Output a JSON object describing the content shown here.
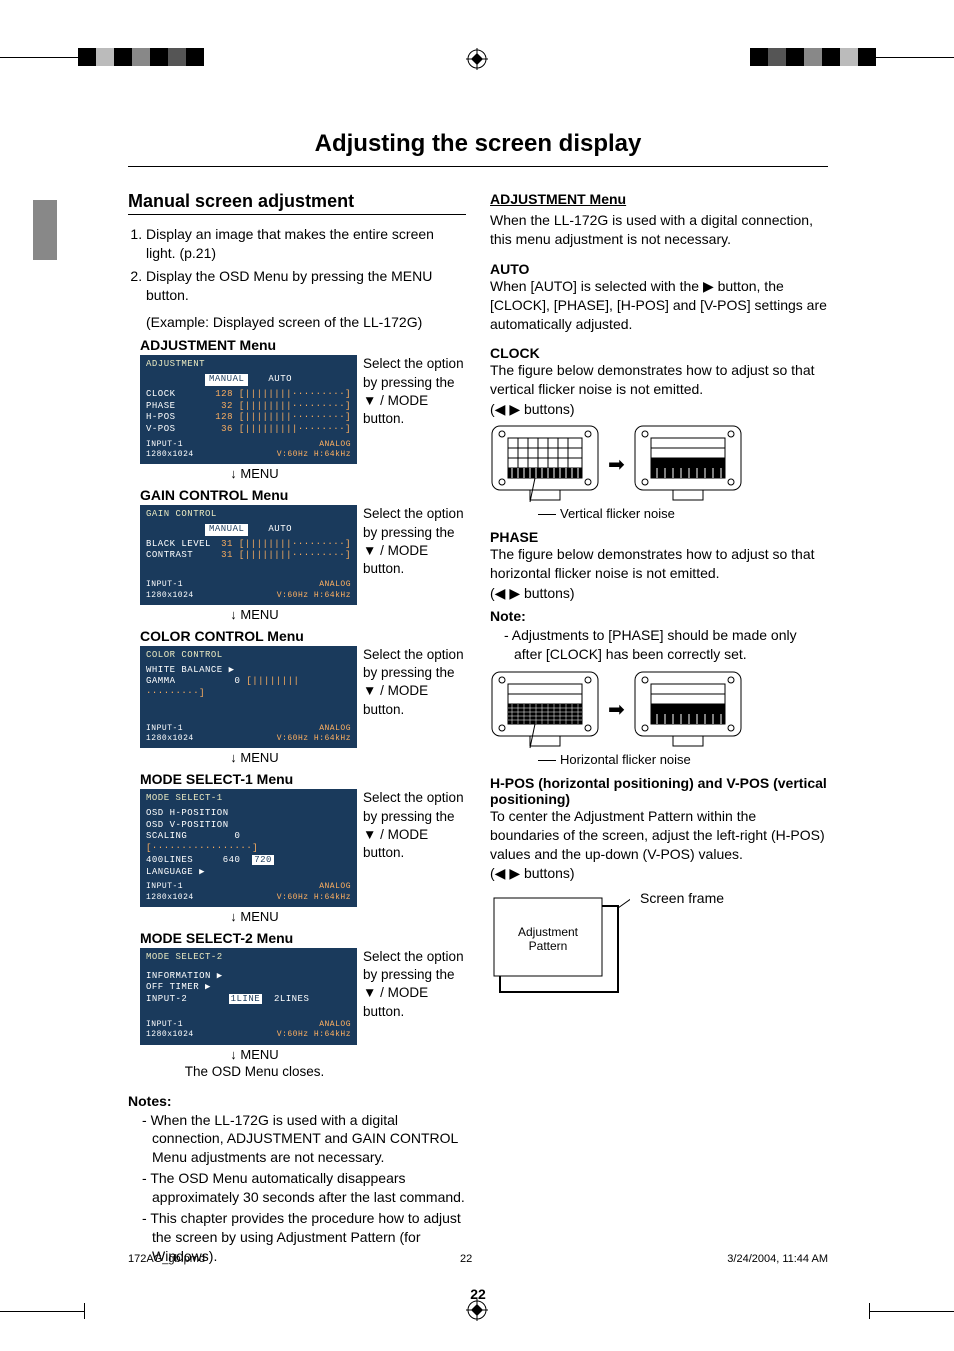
{
  "main_title": "Adjusting the screen display",
  "left": {
    "section_title": "Manual screen adjustment",
    "steps": [
      "Display an image that makes the entire screen light. (p.21)",
      "Display the OSD Menu by pressing the MENU button."
    ],
    "example": "(Example: Displayed screen of the LL-172G)",
    "menus": {
      "adjustment": {
        "label": "ADJUSTMENT Menu",
        "osd_title": "ADJUSTMENT",
        "tabs": [
          "MANUAL",
          "AUTO"
        ],
        "rows": [
          {
            "k": "CLOCK",
            "v": "128"
          },
          {
            "k": "PHASE",
            "v": "32"
          },
          {
            "k": "H-POS",
            "v": "128"
          },
          {
            "k": "V-POS",
            "v": "36"
          }
        ]
      },
      "gain": {
        "label": "GAIN CONTROL Menu",
        "osd_title": "GAIN CONTROL",
        "tabs": [
          "MANUAL",
          "AUTO"
        ],
        "rows": [
          {
            "k": "BLACK LEVEL",
            "v": "31"
          },
          {
            "k": "CONTRAST",
            "v": "31"
          }
        ]
      },
      "color": {
        "label": "COLOR CONTROL Menu",
        "osd_title": "COLOR CONTROL",
        "rows_plain": [
          "WHITE BALANCE ▶",
          "GAMMA            0 [||||||||·········]"
        ]
      },
      "mode1": {
        "label": "MODE SELECT-1 Menu",
        "osd_title": "MODE SELECT-1",
        "rows_plain": [
          "OSD H-POSITION",
          "OSD V-POSITION",
          "SCALING          0 [·················]",
          "400LINES       640   720",
          "LANGUAGE ▶"
        ]
      },
      "mode2": {
        "label": "MODE SELECT-2 Menu",
        "osd_title": "MODE SELECT-2",
        "rows_plain": [
          "INFORMATION ▶",
          "OFF TIMER  ▶",
          "INPUT-2        1LINE  2LINES"
        ]
      },
      "footer": {
        "input": "INPUT-1",
        "res": "1280x1024",
        "mode": "ANALOG",
        "freq": "V:60Hz  H:64kHz"
      }
    },
    "side_text": "Select the option by pressing the ▼ / MODE button.",
    "menu_arrow": "↓ MENU",
    "close_text": "The OSD Menu closes.",
    "notes_title": "Notes:",
    "notes": [
      "When the LL-172G is used with a digital connection, ADJUSTMENT and GAIN CONTROL Menu adjustments are not necessary.",
      "The OSD Menu automatically disappears approximately 30 seconds after the last command.",
      "This chapter provides the procedure how to adjust the screen by using Adjustment Pattern (for Windows)."
    ]
  },
  "right": {
    "adj_title": "ADJUSTMENT Menu",
    "adj_text": "When the LL-172G is used with a digital connection, this menu adjustment is not necessary.",
    "auto_title": "AUTO",
    "auto_text": "When [AUTO] is selected with the ▶ button, the [CLOCK], [PHASE], [H-POS] and [V-POS] settings are automatically adjusted.",
    "clock_title": "CLOCK",
    "clock_text": "The figure below demonstrates how to adjust so that vertical flicker noise is not emitted.",
    "clock_btns": "(◀ ▶ buttons)",
    "clock_caption": "Vertical flicker noise",
    "phase_title": "PHASE",
    "phase_text": "The figure below demonstrates how to adjust so that horizontal flicker noise is not emitted.",
    "phase_btns": "(◀ ▶ buttons)",
    "phase_note_title": "Note:",
    "phase_note": "Adjustments to [PHASE] should be made only after [CLOCK] has been correctly set.",
    "phase_caption": "Horizontal flicker noise",
    "hpos_title": "H-POS (horizontal positioning) and V-POS (vertical positioning)",
    "hpos_text": "To center the Adjustment Pattern within the boundaries of the screen, adjust the left-right (H-POS) values and the up-down (V-POS) values.",
    "hpos_btns": "(◀ ▶ buttons)",
    "frame_label": "Screen frame",
    "pattern_label": "Adjustment Pattern"
  },
  "page_number": "22",
  "footer": {
    "file": "172AG_gb.pmd",
    "page": "22",
    "date": "3/24/2004, 11:44 AM"
  }
}
